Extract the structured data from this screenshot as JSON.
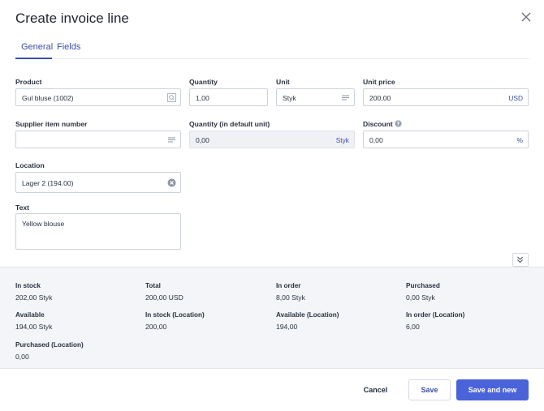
{
  "dialog": {
    "title": "Create invoice line"
  },
  "tabs": [
    {
      "label": "General"
    },
    {
      "label": "Fields"
    }
  ],
  "form": {
    "product": {
      "label": "Product",
      "value": "Gul bluse (1002)"
    },
    "quantity": {
      "label": "Quantity",
      "value": "1,00"
    },
    "unit": {
      "label": "Unit",
      "value": "Styk"
    },
    "unit_price": {
      "label": "Unit price",
      "value": "200,00",
      "currency": "USD"
    },
    "supplier_item_number": {
      "label": "Supplier item number",
      "value": ""
    },
    "quantity_default_unit": {
      "label": "Quantity (in default unit)",
      "value": "0,00",
      "unit": "Styk"
    },
    "discount": {
      "label": "Discount",
      "value": "0,00",
      "suffix": "%"
    },
    "location": {
      "label": "Location",
      "value": "Lager 2 (194.00)"
    },
    "text": {
      "label": "Text",
      "value": "Yellow blouse"
    }
  },
  "summary": [
    {
      "label": "In stock",
      "value": "202,00 Styk"
    },
    {
      "label": "Total",
      "value": "200,00 USD"
    },
    {
      "label": "In order",
      "value": "8,00 Styk"
    },
    {
      "label": "Purchased",
      "value": "0,00 Styk"
    },
    {
      "label": "Available",
      "value": "194,00 Styk"
    },
    {
      "label": "In stock (Location)",
      "value": "200,00"
    },
    {
      "label": "Available (Location)",
      "value": "194,00"
    },
    {
      "label": "In order (Location)",
      "value": "6,00"
    },
    {
      "label": "Purchased (Location)",
      "value": "0,00"
    }
  ],
  "actions": {
    "cancel": "Cancel",
    "save": "Save",
    "save_and_new": "Save and new"
  },
  "colors": {
    "accent": "#4a63d8",
    "link": "#3b4fa8",
    "summary_bg": "#f3f5f8"
  },
  "icons": [
    "close-icon",
    "search-icon",
    "list-icon",
    "help-icon",
    "clear-icon",
    "chevron-double-down-icon"
  ]
}
